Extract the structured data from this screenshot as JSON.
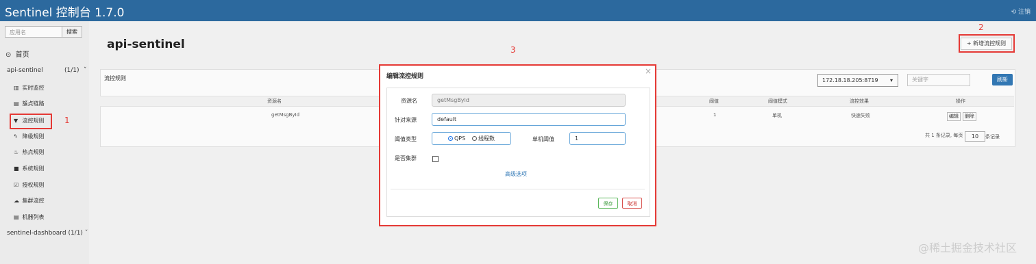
{
  "app": {
    "title": "Sentinel 控制台 1.7.0",
    "logout": "注销"
  },
  "sidebar": {
    "search_placeholder": "应用名",
    "search_button": "搜索",
    "home": "首页",
    "apps": [
      {
        "name": "api-sentinel",
        "count": "(1/1)"
      },
      {
        "name": "sentinel-dashboard",
        "count": "(1/1)"
      }
    ],
    "menu": [
      {
        "icon": "bar-chart-icon",
        "glyph": "▥",
        "label": "实时监控"
      },
      {
        "icon": "list-icon",
        "glyph": "▤",
        "label": "簇点链路"
      },
      {
        "icon": "filter-icon",
        "glyph": "▼",
        "label": "流控规则"
      },
      {
        "icon": "flash-icon",
        "glyph": "ϟ",
        "label": "降级规则"
      },
      {
        "icon": "fire-icon",
        "glyph": "♨",
        "label": "热点规则"
      },
      {
        "icon": "lock-icon",
        "glyph": "■",
        "label": "系统规则"
      },
      {
        "icon": "check-icon",
        "glyph": "☑",
        "label": "授权规则"
      },
      {
        "icon": "cloud-icon",
        "glyph": "☁",
        "label": "集群流控"
      },
      {
        "icon": "server-icon",
        "glyph": "▤",
        "label": "机器列表"
      }
    ]
  },
  "main": {
    "title": "api-sentinel",
    "add_button": "新增流控规则",
    "panel_title": "流控规则",
    "ip_select": "172.18.18.205:8719",
    "keyword_placeholder": "关键字",
    "refresh": "刷新",
    "columns": [
      "资源名",
      "阈值",
      "阈值模式",
      "流控效果",
      "操作"
    ],
    "rows": [
      {
        "resource": "getMsgById",
        "threshold": "1",
        "mode": "单机",
        "effect": "快速失败",
        "edit": "编辑",
        "delete": "删除"
      }
    ],
    "pagination": {
      "prefix": "共 1 条记录, 每页",
      "page_size": "10",
      "suffix": "条记录"
    }
  },
  "modal": {
    "title": "编辑流控规则",
    "close": "×",
    "resource_label": "资源名",
    "resource_value": "getMsgById",
    "source_label": "针对来源",
    "source_value": "default",
    "threshold_type_label": "阈值类型",
    "options": [
      "QPS",
      "线程数"
    ],
    "single_threshold_label": "单机阈值",
    "single_threshold_value": "1",
    "cluster_label": "是否集群",
    "advanced": "高级选项",
    "save": "保存",
    "cancel": "取消"
  },
  "annotations": [
    "1",
    "2",
    "3"
  ],
  "watermark": "@稀土掘金技术社区",
  "colors": {
    "header": "#2d6ca2",
    "primary": "#337ab7",
    "annotation": "#e53935"
  }
}
